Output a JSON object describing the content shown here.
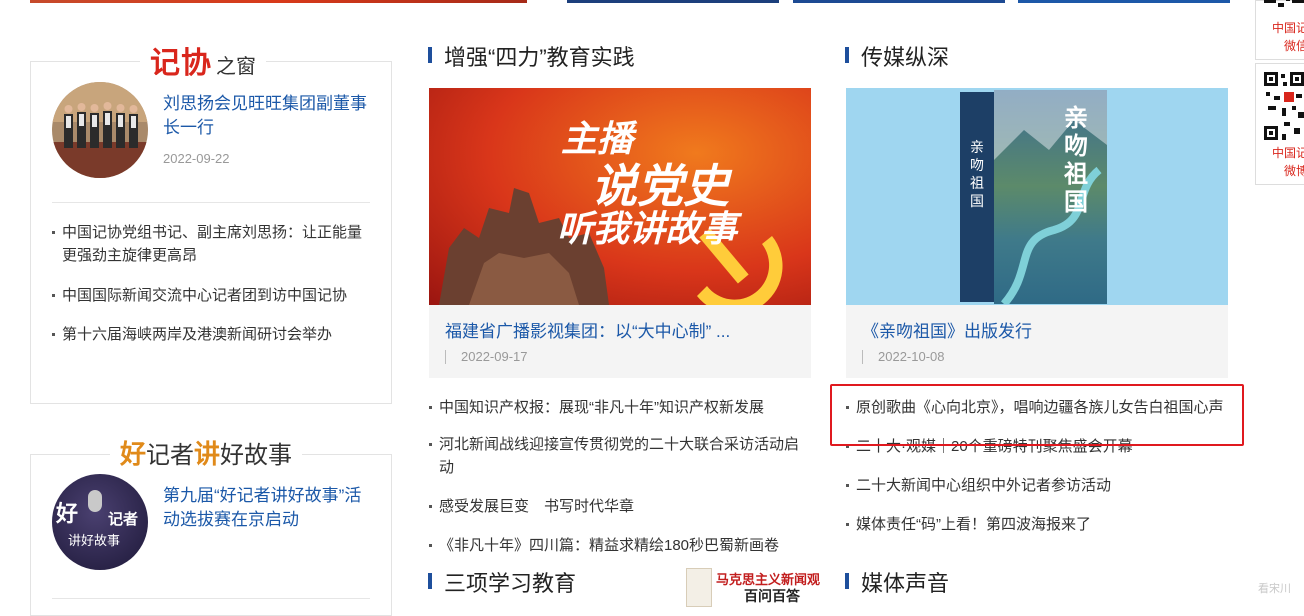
{
  "colors": {
    "link_blue": "#1b58a8",
    "accent_red": "#d9261c",
    "section_bar": "#1e4f9c",
    "highlight_red": "#e0191f"
  },
  "left": {
    "jixie": {
      "title_red": "记协",
      "title_small": "之窗",
      "lead": {
        "title": "刘思扬会见旺旺集团副董事长一行",
        "date": "2022-09-22"
      },
      "items": [
        "中国记协党组书记、副主席刘思扬：让正能量更强劲主旋律更高昂",
        "中国国际新闻交流中心记者团到访中国记协",
        "第十六届海峡两岸及港澳新闻研讨会举办"
      ]
    },
    "haojizhe": {
      "title_c1": "好",
      "title_c2": "记者",
      "title_c3": "讲",
      "title_c4": "好故事",
      "lead": {
        "title": "第九届“好记者讲好故事”活动选拔赛在京启动"
      },
      "avatar_text_1": "好",
      "avatar_text_2": "记者",
      "avatar_text_3": "讲好故事"
    }
  },
  "middle": {
    "heading": "增强“四力”教育实践",
    "feature": {
      "img_line1": "主播",
      "img_line2": "说党史",
      "img_line3": "听我讲故事",
      "title": "福建省广播影视集团：以“大中心制” ...",
      "date": "2022-09-17"
    },
    "items": [
      "中国知识产权报：展现“非凡十年”知识产权新发展",
      "河北新闻战线迎接宣传贯彻党的二十大联合采访活动启动",
      "感受发展巨变　书写时代华章",
      "《非凡十年》四川篇：精益求精绘180秒巴蜀新画卷"
    ],
    "next_heading": "三项学习教育",
    "book_banner_title": "马克思主义新闻观",
    "book_banner_sub": "百问百答"
  },
  "right": {
    "heading": "传媒纵深",
    "feature": {
      "book_title": "亲吻祖国",
      "book_spine": "亲吻祖国",
      "title": "《亲吻祖国》出版发行",
      "date": "2022-10-08"
    },
    "items": [
      "原创歌曲《心向北京》，唱响边疆各族儿女告白祖国心声",
      "二十大·观媒｜20个重磅特刊聚焦盛会开幕",
      "二十大新闻中心组织中外记者参访活动",
      "媒体责任“码”上看！第四波海报来了"
    ],
    "next_heading": "媒体声音"
  },
  "rail": {
    "qr1_caption_1": "中国记",
    "qr1_caption_2": "微信",
    "qr2_caption_1": "中国记",
    "qr2_caption_2": "微博"
  },
  "watermark": "看宋川"
}
